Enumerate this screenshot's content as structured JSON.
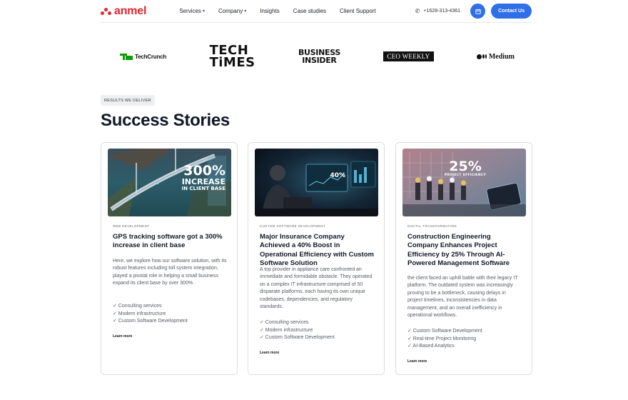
{
  "brand": {
    "name": "anmel",
    "color": "#e3262f"
  },
  "nav": {
    "items": [
      {
        "label": "Services",
        "has_dropdown": true
      },
      {
        "label": "Company",
        "has_dropdown": true
      },
      {
        "label": "Insights",
        "has_dropdown": false
      },
      {
        "label": "Case studies",
        "has_dropdown": false
      },
      {
        "label": "Client Support",
        "has_dropdown": false
      }
    ],
    "phone": "+1628-313-4361",
    "calendar_icon": "calendar-icon",
    "contact_label": "Contact Us",
    "accent_color": "#2f6fe8"
  },
  "press_logos": [
    {
      "name": "TechCrunch",
      "text": "TechCrunch"
    },
    {
      "name": "Tech Times",
      "line1": "TECH",
      "line2": "TiMES"
    },
    {
      "name": "Business Insider",
      "line1": "BUSINESS",
      "line2": "INSIDER"
    },
    {
      "name": "CEO Weekly",
      "text": "CEO WEEKLY"
    },
    {
      "name": "Medium",
      "text": "Medium"
    }
  ],
  "section": {
    "eyebrow": "RESULTS WE DELIVER",
    "title": "Success Stories"
  },
  "cards": [
    {
      "image_big": "300%",
      "image_sub1": "INCREASE",
      "image_sub2": "IN CLIENT BASE",
      "category": "WEB DEVELOPMENT",
      "title": "GPS tracking software got a 300% increase in client base",
      "description": "Here, we explore how our software solution, with its robust features including toll system integration, played a pivotal role in helping a small business expand its client base by over 300%.",
      "features": [
        "✓ Consulting services",
        "✓ Modern infrastructure",
        "✓ Custom Software Development"
      ],
      "link": "Learn more"
    },
    {
      "image_big": "40%",
      "category": "CUSTOM SOFTWARE DEVELOPMENT",
      "title": "Major Insurance Company Achieved a 40% Boost in Operational Efficiency with Custom Software Solution",
      "description": "A top provider in appliance care confronted an immediate and formidable obstacle. They operated on a complex IT infrastructure comprised of 50 disparate platforms, each having its own unique codebases, dependencies, and regulatory standards.",
      "features": [
        "✓ Consulting services",
        "✓ Modern infrastructure",
        "✓ Custom Software Development"
      ],
      "link": "Learn more"
    },
    {
      "image_big": "25%",
      "image_sub1": "PROJECT EFFICIENCY",
      "category": "DIGITAL TRANSFORMATION",
      "title": "Construction Engineering Company Enhances Project Efficiency by 25% Through AI-Powered Management Software",
      "description": "the client faced an uphill battle with their legacy IT platform. The outdated system was increasingly proving to be a bottleneck, causing delays in project timelines, inconsistencies in data management, and an overall inefficiency in operational workflows.",
      "features": [
        "✓ Custom Software Development",
        "✓ Real-time Project Monitoring",
        "✓ AI-Based Analytics"
      ],
      "link": "Learn more"
    }
  ]
}
